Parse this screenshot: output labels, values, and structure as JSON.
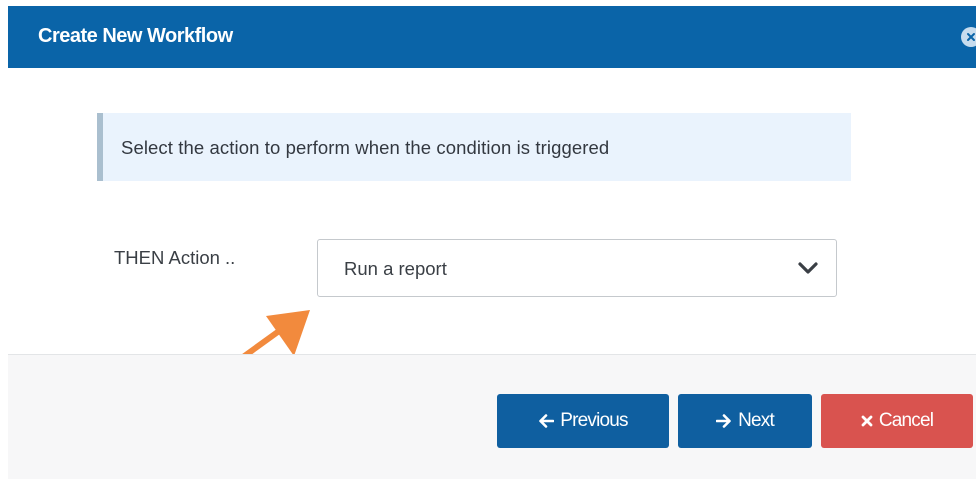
{
  "dialog": {
    "title": "Create New Workflow",
    "header_color": "#0a64a8",
    "close_icon": "close-circle-icon"
  },
  "info": {
    "text": "Select the action to perform when the condition is triggered"
  },
  "form": {
    "action_label": "THEN Action ..",
    "action_select": {
      "selected_value": "Run a report",
      "icon": "chevron-down-icon"
    }
  },
  "annotation": {
    "arrow_color": "#f28a3d",
    "icon": "pointer-arrow-icon"
  },
  "footer": {
    "previous_label": "Previous",
    "previous_icon": "arrow-left-icon",
    "next_label": "Next",
    "next_icon": "arrow-right-icon",
    "cancel_label": "Cancel",
    "cancel_icon": "x-icon",
    "primary_color": "#0f5fa0",
    "danger_color": "#d9534f"
  }
}
